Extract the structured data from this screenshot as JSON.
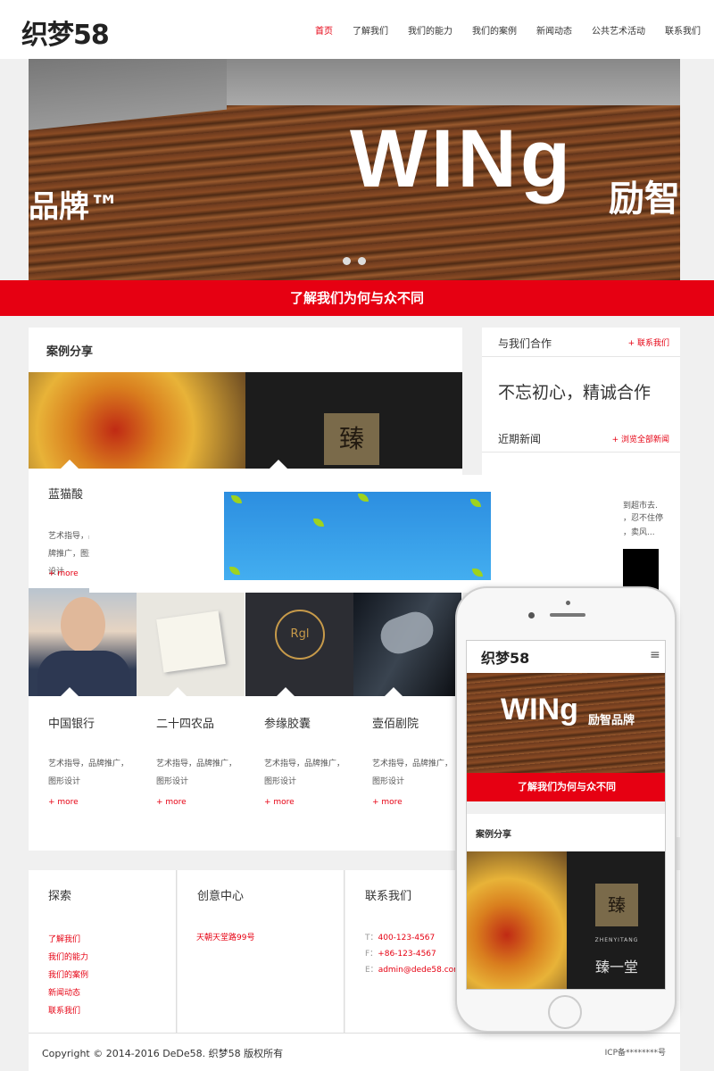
{
  "header": {
    "logo": "织梦58",
    "nav": [
      "首页",
      "了解我们",
      "我们的能力",
      "我们的案例",
      "新闻动态",
      "公共艺术活动",
      "联系我们"
    ]
  },
  "banner": {
    "headline": "WINg",
    "brand": "励智",
    "brand_left": "品牌™"
  },
  "redbar": "了解我们为何与众不同",
  "cases": {
    "title": "案例分享",
    "first": {
      "name": "蓝猫酸",
      "desc": "艺术指导，品牌推广，图形设计",
      "more": "+ more"
    },
    "seal_text": "臻",
    "r3_text": "Rgl",
    "items": [
      {
        "name": "中国银行",
        "desc": "艺术指导，品牌推广，图形设计",
        "more": "+ more"
      },
      {
        "name": "二十四农品",
        "desc": "艺术指导，品牌推广，图形设计",
        "more": "+ more"
      },
      {
        "name": "参缘胶囊",
        "desc": "艺术指导，品牌推广，图形设计",
        "more": "+ more"
      },
      {
        "name": "壹佰剧院",
        "desc": "艺术指导，品牌推广，图形设计",
        "more": "+ more"
      }
    ]
  },
  "sidebar": {
    "coop_title": "与我们合作",
    "coop_link": "+ 联系我们",
    "slogan": "不忘初心，精诚合作",
    "news_title": "近期新闻",
    "news_link": "+ 浏览全部新闻",
    "news_fragments": [
      "到超市去.",
      "，忍不住停",
      "，卖风..."
    ]
  },
  "footer": {
    "col1_title": "探索",
    "col1_links": [
      "了解我们",
      "我们的能力",
      "我们的案例",
      "新闻动态",
      "联系我们"
    ],
    "col2_title": "创意中心",
    "address": "天朝天堂路99号",
    "col3_title": "联系我们",
    "tel_label": "T：",
    "tel": "400-123-4567",
    "fax_label": "F：",
    "fax": "+86-123-4567",
    "email_label": "E：",
    "email": "admin@dede58.com",
    "copyright": "Copyright © 2014-2016 DeDe58. 织梦58 版权所有",
    "icp": "ICP备********号"
  },
  "phone": {
    "logo": "织梦58",
    "menu_icon": "≡",
    "headline": "WINg",
    "brand": "励智品牌",
    "redbar": "了解我们为何与众不同",
    "cases_title": "案例分享",
    "seal": "臻",
    "seal_en": "ZHENYITANG",
    "seal_cn": "臻一堂"
  }
}
